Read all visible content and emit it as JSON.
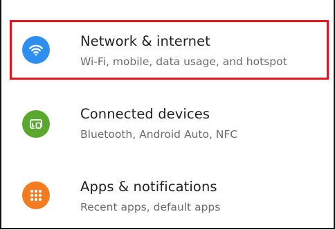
{
  "settings": {
    "items": [
      {
        "title": "Network & internet",
        "subtitle": "Wi-Fi, mobile, data usage, and hotspot",
        "icon": "wifi-icon",
        "color": "#2f8ff0"
      },
      {
        "title": "Connected devices",
        "subtitle": "Bluetooth, Android Auto, NFC",
        "icon": "connected-devices-icon",
        "color": "#5aa82e"
      },
      {
        "title": "Apps & notifications",
        "subtitle": "Recent apps, default apps",
        "icon": "apps-grid-icon",
        "color": "#f47b20"
      }
    ]
  },
  "colors": {
    "highlight": "#e8141b"
  }
}
